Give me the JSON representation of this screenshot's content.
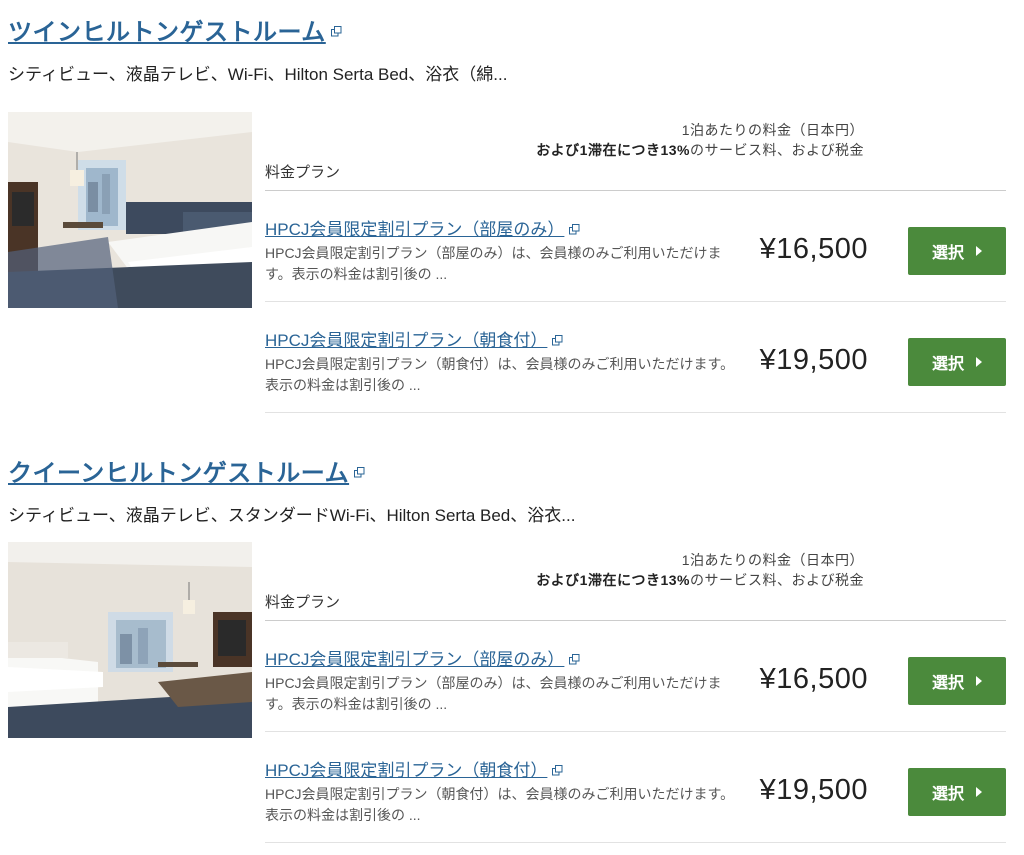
{
  "rooms": [
    {
      "title": "ツインヒルトンゲストルーム",
      "description": "シティビュー、液晶テレビ、Wi-Fi、Hilton Serta Bed、浴衣（綿...",
      "plans_header": {
        "label": "料金プラン",
        "rate_line1": "1泊あたりの料金（日本円）",
        "rate_line2_bold": "および1滞在につき13%",
        "rate_line2_rest": "のサービス料、および税金"
      },
      "plans": [
        {
          "name": "HPCJ会員限定割引プラン（部屋のみ）",
          "description": "HPCJ会員限定割引プラン（部屋のみ）は、会員様のみご利用いただけます。表示の料金は割引後の ...",
          "price": "¥16,500",
          "button": "選択"
        },
        {
          "name": "HPCJ会員限定割引プラン（朝食付）",
          "description": "HPCJ会員限定割引プラン（朝食付）は、会員様のみご利用いただけます。表示の料金は割引後の ...",
          "price": "¥19,500",
          "button": "選択"
        }
      ]
    },
    {
      "title": "クイーンヒルトンゲストルーム",
      "description": "シティビュー、液晶テレビ、スタンダードWi-Fi、Hilton Serta Bed、浴衣...",
      "plans_header": {
        "label": "料金プラン",
        "rate_line1": "1泊あたりの料金（日本円）",
        "rate_line2_bold": "および1滞在につき13%",
        "rate_line2_rest": "のサービス料、および税金"
      },
      "plans": [
        {
          "name": "HPCJ会員限定割引プラン（部屋のみ）",
          "description": "HPCJ会員限定割引プラン（部屋のみ）は、会員様のみご利用いただけます。表示の料金は割引後の ...",
          "price": "¥16,500",
          "button": "選択"
        },
        {
          "name": "HPCJ会員限定割引プラン（朝食付）",
          "description": "HPCJ会員限定割引プラン（朝食付）は、会員様のみご利用いただけます。表示の料金は割引後の ...",
          "price": "¥19,500",
          "button": "選択"
        }
      ]
    }
  ],
  "colors": {
    "link": "#2a6496",
    "select_button": "#4b8a3c"
  },
  "icons": {
    "external_link": "external-link-icon",
    "select_arrow": "triangle-right-icon"
  }
}
